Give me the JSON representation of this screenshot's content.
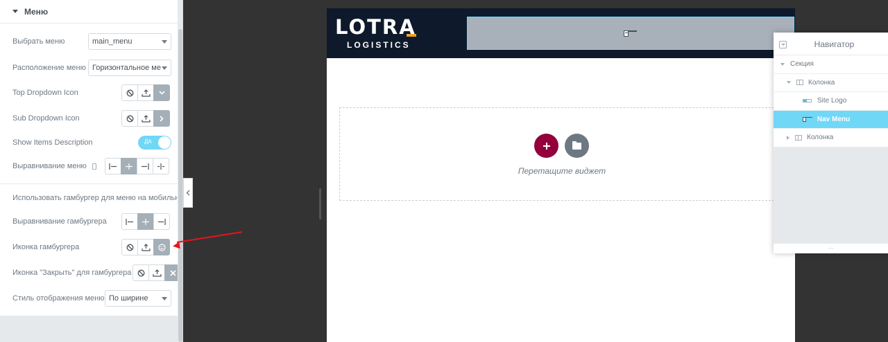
{
  "panel": {
    "section_title": "Меню",
    "rows": {
      "select_menu_label": "Выбрать меню",
      "select_menu_value": "main_menu",
      "layout_label": "Расположение меню",
      "layout_value": "Горизонтальное ме",
      "top_dropdown_label": "Top Dropdown Icon",
      "sub_dropdown_label": "Sub Dropdown Icon",
      "show_desc_label": "Show Items Description",
      "show_desc_value": "ДА",
      "align_label": "Выравнивание меню",
      "use_hamburger_label": "Использовать гамбургер для меню на мобильном",
      "hamburger_align_label": "Выравнивание гамбургера",
      "hamburger_icon_label": "Иконка гамбургера",
      "close_icon_label": "Иконка \"Закрыть\" для гамбургера",
      "display_style_label": "Стиль отображения меню",
      "display_style_value": "По ширине"
    }
  },
  "canvas": {
    "logo_main": "LOTRA",
    "logo_sub": "LOGISTICS",
    "drop_text": "Перетащите виджет"
  },
  "navigator": {
    "title": "Навигатор",
    "items": [
      {
        "label": "Секция"
      },
      {
        "label": "Колонка"
      },
      {
        "label": "Site Logo"
      },
      {
        "label": "Nav Menu"
      },
      {
        "label": "Колонка"
      }
    ],
    "footer": "..."
  },
  "colors": {
    "accent": "#71d7f7",
    "add_button": "#93003c",
    "header_bg": "#0e1a2b",
    "logo_accent": "#f4a21c",
    "annotation_arrow": "#e8141b"
  }
}
